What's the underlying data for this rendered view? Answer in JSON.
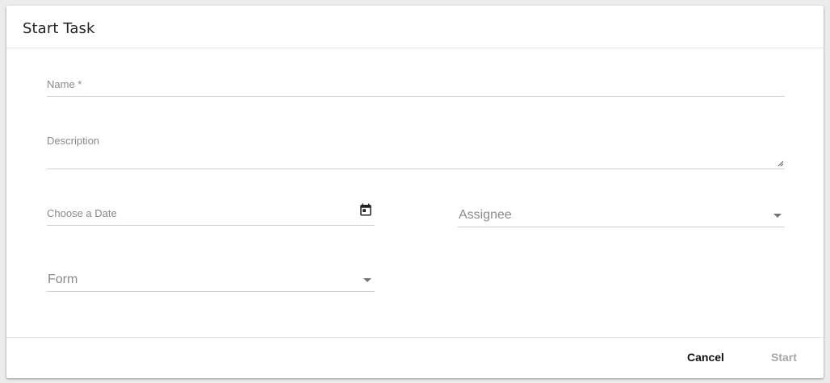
{
  "dialog": {
    "title": "Start Task"
  },
  "form": {
    "name_label": "Name *",
    "description_label": "Description",
    "date_label": "Choose a Date",
    "date_icon": "calendar-icon",
    "assignee_label": "Assignee",
    "form_label": "Form"
  },
  "footer": {
    "cancel_label": "Cancel",
    "start_label": "Start"
  },
  "colors": {
    "primary_text": "#222222",
    "label_text": "#8a8a8a",
    "disabled_text": "#a8a8a8",
    "divider": "#cfcfcf"
  }
}
